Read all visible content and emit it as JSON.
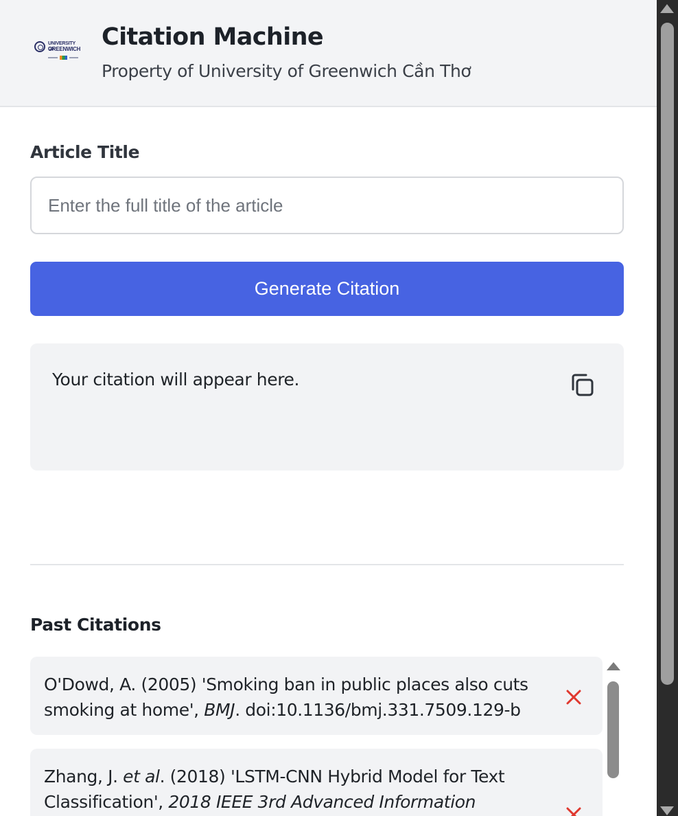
{
  "header": {
    "logo_text_line1": "UNIVERSITY OF",
    "logo_text_line2": "GREENWICH",
    "title": "Citation Machine",
    "subtitle": "Property of University of Greenwich Cần Thơ"
  },
  "form": {
    "article_title_label": "Article Title",
    "article_title_placeholder": "Enter the full title of the article",
    "article_title_value": "",
    "generate_button_label": "Generate Citation"
  },
  "output": {
    "text": "Your citation will appear here.",
    "copy_icon": "copy-icon"
  },
  "past_citations": {
    "heading": "Past Citations",
    "items": [
      {
        "lead": "O'Dowd, A. (2005) 'Smoking ban in public places also cuts smoking at home', ",
        "italic": "BMJ",
        "trail": ". doi:10.1136/bmj.331.7509.129-b"
      },
      {
        "lead": "Zhang, J. ",
        "italic_author": "et al",
        "mid": ". (2018) 'LSTM-CNN Hybrid Model for Text Classification', ",
        "italic": "2018 IEEE 3rd Advanced Information",
        "trail": ""
      }
    ],
    "delete_icon": "close-icon"
  },
  "colors": {
    "primary": "#4763e2",
    "delete": "#e0382e",
    "header_bg": "#f3f4f6",
    "panel_bg": "#f2f3f5"
  }
}
